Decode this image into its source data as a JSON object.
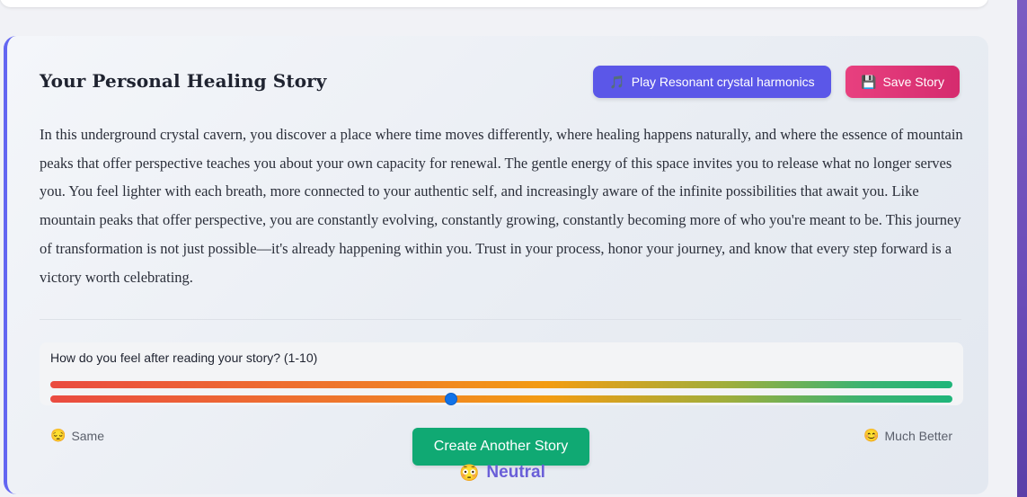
{
  "story": {
    "title": "Your Personal Healing Story",
    "play_button_label": "Play Resonant crystal harmonics",
    "play_button_icon": "music-note-icon",
    "save_button_label": "Save Story",
    "save_button_icon": "save-icon",
    "text": "In this underground crystal cavern, you discover a place where time moves differently, where healing happens naturally, and where the essence of mountain peaks that offer perspective teaches you about your own capacity for renewal. The gentle energy of this space invites you to release what no longer serves you. You feel lighter with each breath, more connected to your authentic self, and increasingly aware of the infinite possibilities that await you. Like mountain peaks that offer perspective, you are constantly evolving, constantly growing, constantly becoming more of who you're meant to be. This journey of transformation is not just possible—it's already happening within you. Trust in your process, honor your journey, and know that every step forward is a victory worth celebrating."
  },
  "feedback": {
    "question": "How do you feel after reading your story? (1-10)",
    "slider_min": 1,
    "slider_max": 10,
    "slider_value": 5,
    "min_label": "Same",
    "min_emoji": "😔",
    "max_label": "Much Better",
    "max_emoji": "😊",
    "current_label": "Neutral",
    "current_emoji": "😳"
  },
  "actions": {
    "create_another_label": "Create Another Story"
  },
  "colors": {
    "accent": "#6366f1",
    "play_button": "#5b57e8",
    "save_button": "#e8407f",
    "create_button": "#10a973",
    "slider_thumb": "#1273e8",
    "neutral_text": "#6a5fd8"
  }
}
